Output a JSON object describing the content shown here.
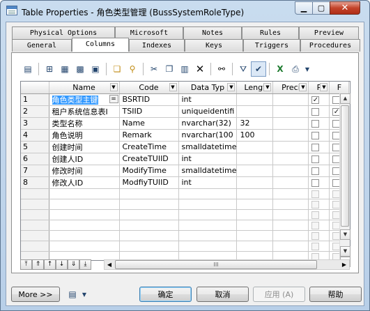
{
  "window": {
    "title": "Table Properties - 角色类型管理 (BussSystemRoleType)"
  },
  "tabs_top": [
    "Physical Options",
    "Microsoft",
    "Notes",
    "Rules",
    "Preview"
  ],
  "tabs_bottom": [
    "General",
    "Columns",
    "Indexes",
    "Keys",
    "Triggers",
    "Procedures"
  ],
  "active_tab": "Columns",
  "toolbar_icons": [
    "properties-icon",
    "insert-row-icon",
    "add-row-icon",
    "add-columns-icon",
    "reuse-columns-icon",
    "new-document-icon",
    "find-icon-2",
    "cut-icon",
    "copy-icon",
    "paste-icon",
    "delete-icon",
    "find-icon",
    "filter-icon",
    "customize-columns-icon",
    "excel-icon",
    "print-icon",
    "dropdown-icon"
  ],
  "grid": {
    "headers": [
      "Name",
      "Code",
      "Data Typ",
      "Lengt",
      "Preci",
      "P",
      "F"
    ],
    "rows": [
      {
        "num": "1",
        "name": "角色类型主键",
        "code": "BSRTID",
        "type": "int",
        "length": "",
        "precision": "",
        "p": true,
        "f": false
      },
      {
        "num": "2",
        "name": "租户系统信息表I",
        "code": "TSIID",
        "type": "uniqueidentifi",
        "length": "",
        "precision": "",
        "p": false,
        "f": true
      },
      {
        "num": "3",
        "name": "类型名称",
        "code": "Name",
        "type": "nvarchar(32)",
        "length": "32",
        "precision": "",
        "p": false,
        "f": false
      },
      {
        "num": "4",
        "name": "角色说明",
        "code": "Remark",
        "type": "nvarchar(100",
        "length": "100",
        "precision": "",
        "p": false,
        "f": false
      },
      {
        "num": "5",
        "name": "创建时间",
        "code": "CreateTime",
        "type": "smalldatetime",
        "length": "",
        "precision": "",
        "p": false,
        "f": false
      },
      {
        "num": "6",
        "name": "创建人ID",
        "code": "CreateTUIID",
        "type": "int",
        "length": "",
        "precision": "",
        "p": false,
        "f": false
      },
      {
        "num": "7",
        "name": "修改时间",
        "code": "ModifyTime",
        "type": "smalldatetime",
        "length": "",
        "precision": "",
        "p": false,
        "f": false
      },
      {
        "num": "8",
        "name": "修改人ID",
        "code": "ModfiyTUIID",
        "type": "int",
        "length": "",
        "precision": "",
        "p": false,
        "f": false
      }
    ],
    "empty_rows": 8,
    "edit_button_label": "="
  },
  "scroll": {
    "thumb_label": "III"
  },
  "buttons": {
    "more": "More >>",
    "ok": "确定",
    "cancel": "取消",
    "apply": "应用 (A)",
    "help": "帮助"
  }
}
